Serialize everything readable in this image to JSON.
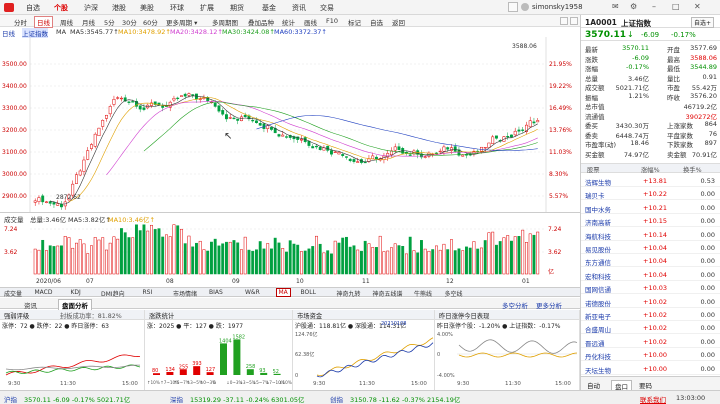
{
  "nav": {
    "items": [
      "自选",
      "个股",
      "沪深",
      "港股",
      "美股",
      "环球",
      "扩展",
      "期货",
      "基金",
      "资讯",
      "交易"
    ],
    "active": 1,
    "user": "simonsky1958"
  },
  "toolbar": {
    "items": [
      "分时",
      "日线",
      "周线",
      "月线",
      "5分",
      "30分",
      "60分",
      "更多周期 ▾",
      "多周期图",
      "叠加品种",
      "统计",
      "画线",
      "F10",
      "标记",
      "自选",
      "返回"
    ],
    "active": 1
  },
  "ma_line": {
    "period": "日线",
    "index": "上证指数",
    "ma": "MA",
    "ma5": "MA5:3545.77↑",
    "ma10": "MA10:3478.92↑",
    "ma20": "MA20:3428.12↑",
    "ma30": "MA30:3424.08↑",
    "ma60": "MA60:3372.37↑"
  },
  "main_chart": {
    "y_ticks": [
      "3500.00",
      "3400.00",
      "3300.00",
      "3200.00",
      "3100.00",
      "3000.00",
      "2900.00"
    ],
    "high_label": "3588.06",
    "low_label": "2872.62",
    "right_ticks": [
      "21.95%",
      "19.22%",
      "16.49%",
      "13.76%",
      "11.03%",
      "8.30%",
      "5.57%"
    ]
  },
  "volume": {
    "label": "成交量",
    "total": "总量:3.46亿",
    "ma5": "MA5:3.82亿↑",
    "ma10": "MA10:3.46亿↑",
    "y_ticks": [
      "7.24",
      "3.62",
      "3.62"
    ],
    "unit": "亿",
    "x_ticks": [
      "2020/06",
      "07",
      "08",
      "09",
      "10",
      "11",
      "12",
      "01"
    ]
  },
  "indicator_tabs": [
    "成交量",
    "MACD",
    "KDJ",
    "DMI趋向",
    "RSI",
    "市场情绪",
    "BIAS",
    "W&R",
    "MA",
    "BOLL",
    "神奇九转",
    "神奇五线谱",
    "牛熊线",
    "多空线"
  ],
  "indicator_active": 8,
  "panel_tabs": [
    "资讯",
    "盘面分析"
  ],
  "panel_right": [
    "多空分析",
    "更多分析"
  ],
  "panels": [
    {
      "title": "强弱评级",
      "extra": "封板成功率：81.82%",
      "legend": "涨停：72  ● 跌停：22  ● 昨日涨停：63",
      "x": [
        "9:30",
        "11:30",
        "15:00"
      ]
    },
    {
      "title": "涨跌统计",
      "legend": "涨：2025  ● 平：127  ● 跌：1977",
      "bars": [
        80,
        134,
        255,
        393,
        127,
        1404,
        1582,
        258,
        93,
        52
      ],
      "x": [
        "↑10%",
        "↑7~10%",
        "↑5~7%",
        "↑3~5%",
        "↑0~3%",
        "0",
        "↓0~3%",
        "↓3~5%",
        "↓5~7%",
        "↓7~10%",
        "↓10%"
      ]
    },
    {
      "title": "市场资金",
      "legend": "沪股通：118.81亿  ● 深股通：114.31亿",
      "y": [
        "124.76亿",
        "62.38亿",
        "0"
      ],
      "x": [
        "9:30",
        "11:30",
        "15:00"
      ],
      "date": "20210108"
    },
    {
      "title": "昨日涨停今日表现",
      "legend": "昨日涨停个股：-1.20%  ● 上证指数：-0.17%",
      "y": [
        "4.00%",
        "0",
        "-4.00%"
      ],
      "x": [
        "9:30",
        "11:30",
        "15:00"
      ]
    }
  ],
  "quote": {
    "code": "1A0001",
    "name": "上证指数",
    "price": "3570.11",
    "arrow": "↓",
    "change": "-6.09",
    "pct": "-0.17%",
    "rows": [
      [
        "最新",
        "3570.11",
        "开盘",
        "3577.69"
      ],
      [
        "涨跌",
        "-6.09",
        "最高",
        "3588.06"
      ],
      [
        "涨幅",
        "-0.17%",
        "最低",
        "3544.89"
      ],
      [
        "总量",
        "3.46亿",
        "量比",
        "0.91"
      ],
      [
        "成交额",
        "5021.71亿",
        "市盈",
        "55.42万"
      ],
      [
        "振幅",
        "1.21%",
        "昨收",
        "3576.20"
      ],
      [
        "总市值",
        "",
        "",
        "46719.2亿"
      ],
      [
        "流通值",
        "",
        "",
        "390272亿"
      ],
      [
        "委买",
        "3430.30万",
        "上涨家数",
        "864"
      ],
      [
        "委卖",
        "6448.74万",
        "平盘家数",
        "76"
      ],
      [
        "市盈率(动)",
        "18.46",
        "下跌家数",
        "897"
      ],
      [
        "买金额",
        "74.97亿",
        "卖金额",
        "70.91亿"
      ]
    ],
    "list_head": [
      "股票",
      "涨幅%",
      "换手%"
    ],
    "list": [
      [
        "浩辉生物",
        "+13.81",
        "0.53"
      ],
      [
        "瑞贝卡",
        "+10.22",
        "0.00"
      ],
      [
        "国中水务",
        "+10.21",
        "0.00"
      ],
      [
        "济南高新",
        "+10.15",
        "0.00"
      ],
      [
        "海航科技",
        "+10.14",
        "0.00"
      ],
      [
        "易见股份",
        "+10.04",
        "0.00"
      ],
      [
        "东方通信",
        "+10.04",
        "0.00"
      ],
      [
        "宏和科技",
        "+10.04",
        "0.00"
      ],
      [
        "国网信通",
        "+10.03",
        "0.00"
      ],
      [
        "诺德股份",
        "+10.02",
        "0.00"
      ],
      [
        "新亚电子",
        "+10.02",
        "0.00"
      ],
      [
        "合盛周山",
        "+10.02",
        "0.00"
      ],
      [
        "晋远通",
        "+10.02",
        "0.00"
      ],
      [
        "丹化科技",
        "+10.00",
        "0.00"
      ],
      [
        "天坛生物",
        "+10.00",
        "0.00"
      ]
    ],
    "bottom_tabs": [
      "自动",
      "盘口",
      "要码"
    ]
  },
  "status": {
    "sh_name": "沪指",
    "sh": "3570.11  -6.09  -0.17%  5021.71亿",
    "sz_name": "深指",
    "sz": "15319.29  -37.11  -0.24%  6301.05亿",
    "cy_name": "创指",
    "cy": "3150.78  -11.62  -0.37%  2154.19亿",
    "service": "联系我们",
    "time": "13:03:00"
  }
}
